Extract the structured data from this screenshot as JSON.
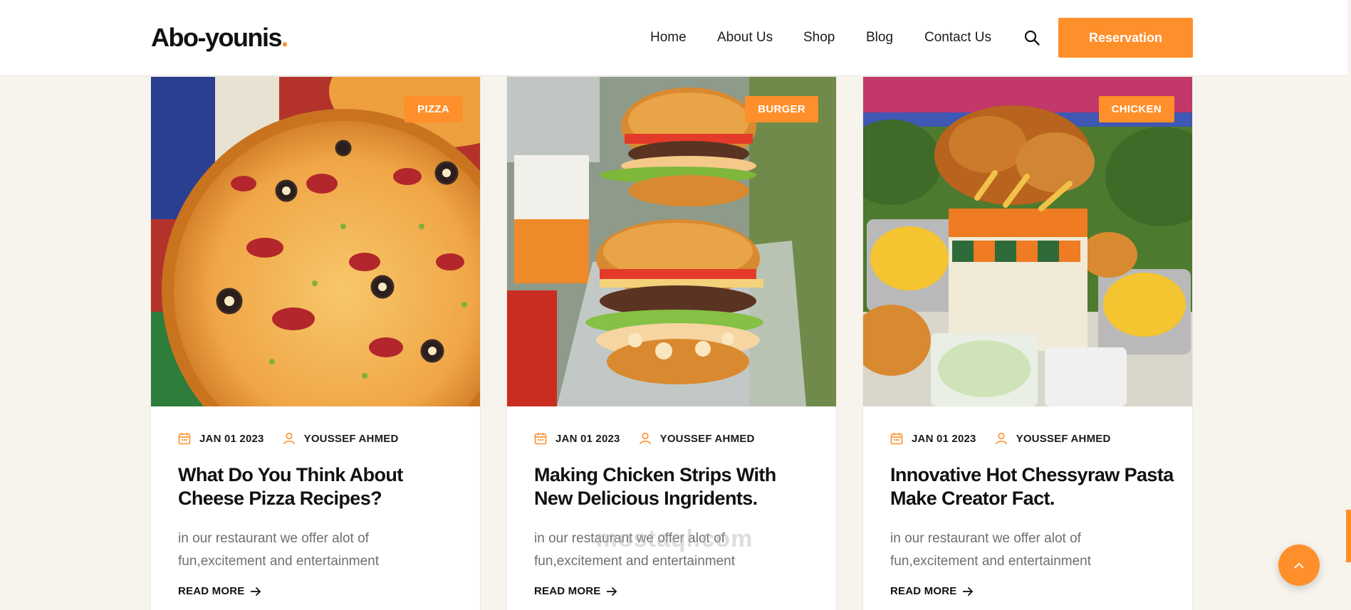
{
  "brand": {
    "name": "Abo-younis",
    "dot": ".",
    "accent": "#ff8f2a"
  },
  "nav": {
    "items": [
      "Home",
      "About Us",
      "Shop",
      "Blog",
      "Contact Us"
    ],
    "search_icon": "search-icon",
    "cta_label": "Reservation"
  },
  "posts": [
    {
      "category": "PIZZA",
      "date": "JAN 01 2023",
      "author": "YOUSSEF AHMED",
      "title": "What Do You Think About Cheese Pizza Recipes?",
      "excerpt": "in our restaurant we offer alot of fun,excitement and entertainment",
      "read_more": "READ MORE"
    },
    {
      "category": "BURGER",
      "date": "JAN 01 2023",
      "author": "YOUSSEF AHMED",
      "title": "Making Chicken Strips With New Delicious Ingridents.",
      "excerpt": "in our restaurant we offer alot of fun,excitement and entertainment",
      "read_more": "READ MORE"
    },
    {
      "category": "CHICKEN",
      "date": "JAN 01 2023",
      "author": "YOUSSEF AHMED",
      "title": "Innovative Hot Chessyraw Pasta Make Creator Fact.",
      "excerpt": "in our restaurant we offer alot of fun,excitement and entertainment",
      "read_more": "READ MORE"
    }
  ],
  "watermark": "mostaql.com"
}
